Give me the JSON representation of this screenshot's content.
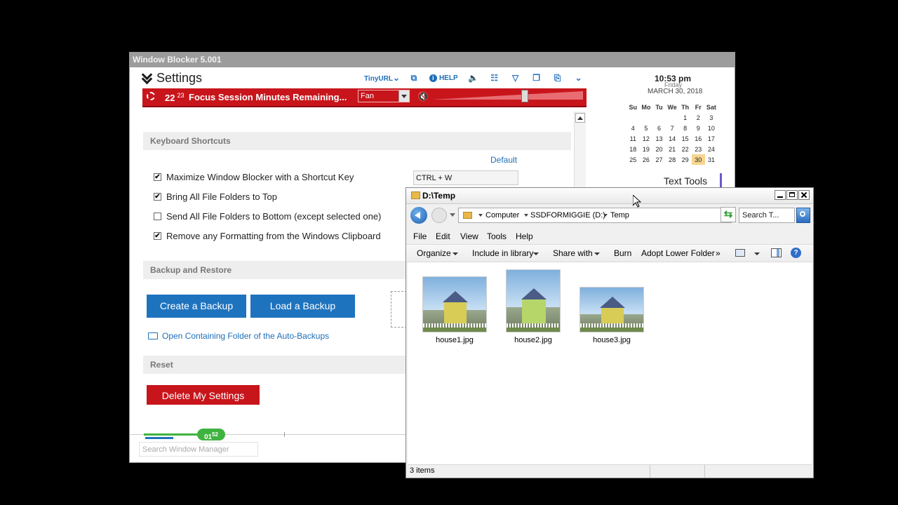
{
  "window_blocker": {
    "title": "Window Blocker 5.001",
    "settings_label": "Settings",
    "toolbar": {
      "tinyurl": "TinyURL",
      "help": "HELP"
    },
    "focus": {
      "minutes": "22",
      "seconds": "23",
      "label": "Focus Session Minutes Remaining...",
      "sound_option": "Fan",
      "volume_percent": 62
    },
    "sections": {
      "keyboard": "Keyboard Shortcuts",
      "backup": "Backup and Restore",
      "reset": "Reset"
    },
    "default_link": "Default",
    "shortcuts": [
      {
        "label": "Maximize Window Blocker with a Shortcut Key",
        "checked": true,
        "mark": "✔"
      },
      {
        "label": "Bring All File Folders to Top",
        "checked": true,
        "mark": "✔"
      },
      {
        "label": "Send All File Folders to Bottom (except selected one)",
        "checked": false,
        "mark": ""
      },
      {
        "label": "Remove any Formatting from the Windows Clipboard",
        "checked": true,
        "mark": "✔"
      }
    ],
    "shortcut_value": "CTRL + W",
    "create_backup": "Create a Backup",
    "load_backup": "Load a Backup",
    "open_folder": "Open Containing Folder of the Auto-Backups",
    "delete_settings": "Delete My Settings",
    "timer_badge": {
      "main": "01",
      "sub": "52"
    },
    "search_placeholder": "Search Window Manager",
    "clock": {
      "time": "10:53 pm",
      "day": "Friday",
      "date": "MARCH 30, 2018",
      "weekdays": [
        "Su",
        "Mo",
        "Tu",
        "We",
        "Th",
        "Fr",
        "Sat"
      ],
      "weeks": [
        [
          "",
          "",
          "",
          "",
          "1",
          "2",
          "3"
        ],
        [
          "4",
          "5",
          "6",
          "7",
          "8",
          "9",
          "10"
        ],
        [
          "11",
          "12",
          "13",
          "14",
          "15",
          "16",
          "17"
        ],
        [
          "18",
          "19",
          "20",
          "21",
          "22",
          "23",
          "24"
        ],
        [
          "25",
          "26",
          "27",
          "28",
          "29",
          "30",
          "31"
        ]
      ],
      "today": "30"
    },
    "text_tools": "Text Tools"
  },
  "explorer": {
    "title": "D:\\Temp",
    "breadcrumbs": [
      "Computer",
      "SSDFORMIGGIE (D:)",
      "Temp"
    ],
    "search_placeholder": "Search T...",
    "menu": [
      "File",
      "Edit",
      "View",
      "Tools",
      "Help"
    ],
    "commands": {
      "organize": "Organize",
      "include": "Include in library",
      "share": "Share with",
      "burn": "Burn",
      "adopt": "Adopt Lower Folder",
      "more": "»"
    },
    "files": [
      {
        "name": "house1.jpg"
      },
      {
        "name": "house2.jpg"
      },
      {
        "name": "house3.jpg"
      }
    ],
    "status": "3 items"
  }
}
